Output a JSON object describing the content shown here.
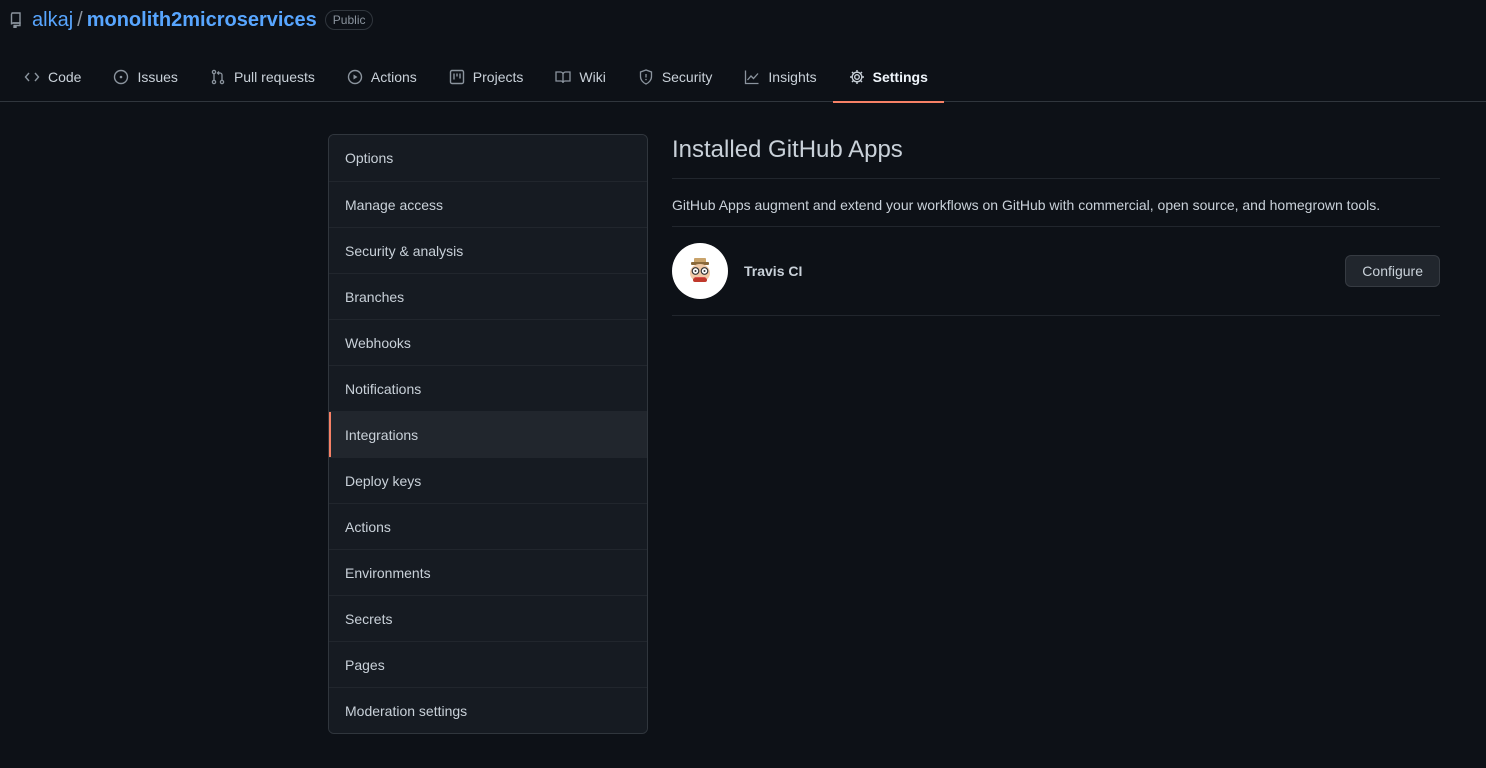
{
  "repo": {
    "owner": "alkaj",
    "separator": "/",
    "name": "monolith2microservices",
    "visibility": "Public"
  },
  "tabs": [
    {
      "label": "Code",
      "icon": "code-icon"
    },
    {
      "label": "Issues",
      "icon": "issue-icon"
    },
    {
      "label": "Pull requests",
      "icon": "pull-request-icon"
    },
    {
      "label": "Actions",
      "icon": "play-icon"
    },
    {
      "label": "Projects",
      "icon": "project-icon"
    },
    {
      "label": "Wiki",
      "icon": "book-icon"
    },
    {
      "label": "Security",
      "icon": "shield-icon"
    },
    {
      "label": "Insights",
      "icon": "graph-icon"
    },
    {
      "label": "Settings",
      "icon": "gear-icon",
      "active": true
    }
  ],
  "sidebar": {
    "items": [
      {
        "label": "Options"
      },
      {
        "label": "Manage access"
      },
      {
        "label": "Security & analysis"
      },
      {
        "label": "Branches"
      },
      {
        "label": "Webhooks"
      },
      {
        "label": "Notifications"
      },
      {
        "label": "Integrations",
        "selected": true
      },
      {
        "label": "Deploy keys"
      },
      {
        "label": "Actions"
      },
      {
        "label": "Environments"
      },
      {
        "label": "Secrets"
      },
      {
        "label": "Pages"
      },
      {
        "label": "Moderation settings"
      }
    ]
  },
  "main": {
    "title": "Installed GitHub Apps",
    "description": "GitHub Apps augment and extend your workflows on GitHub with commercial, open source, and homegrown tools.",
    "apps": [
      {
        "name": "Travis CI",
        "button": "Configure"
      }
    ]
  },
  "colors": {
    "background": "#0d1117",
    "accent": "#f78166",
    "link": "#58a6ff"
  }
}
